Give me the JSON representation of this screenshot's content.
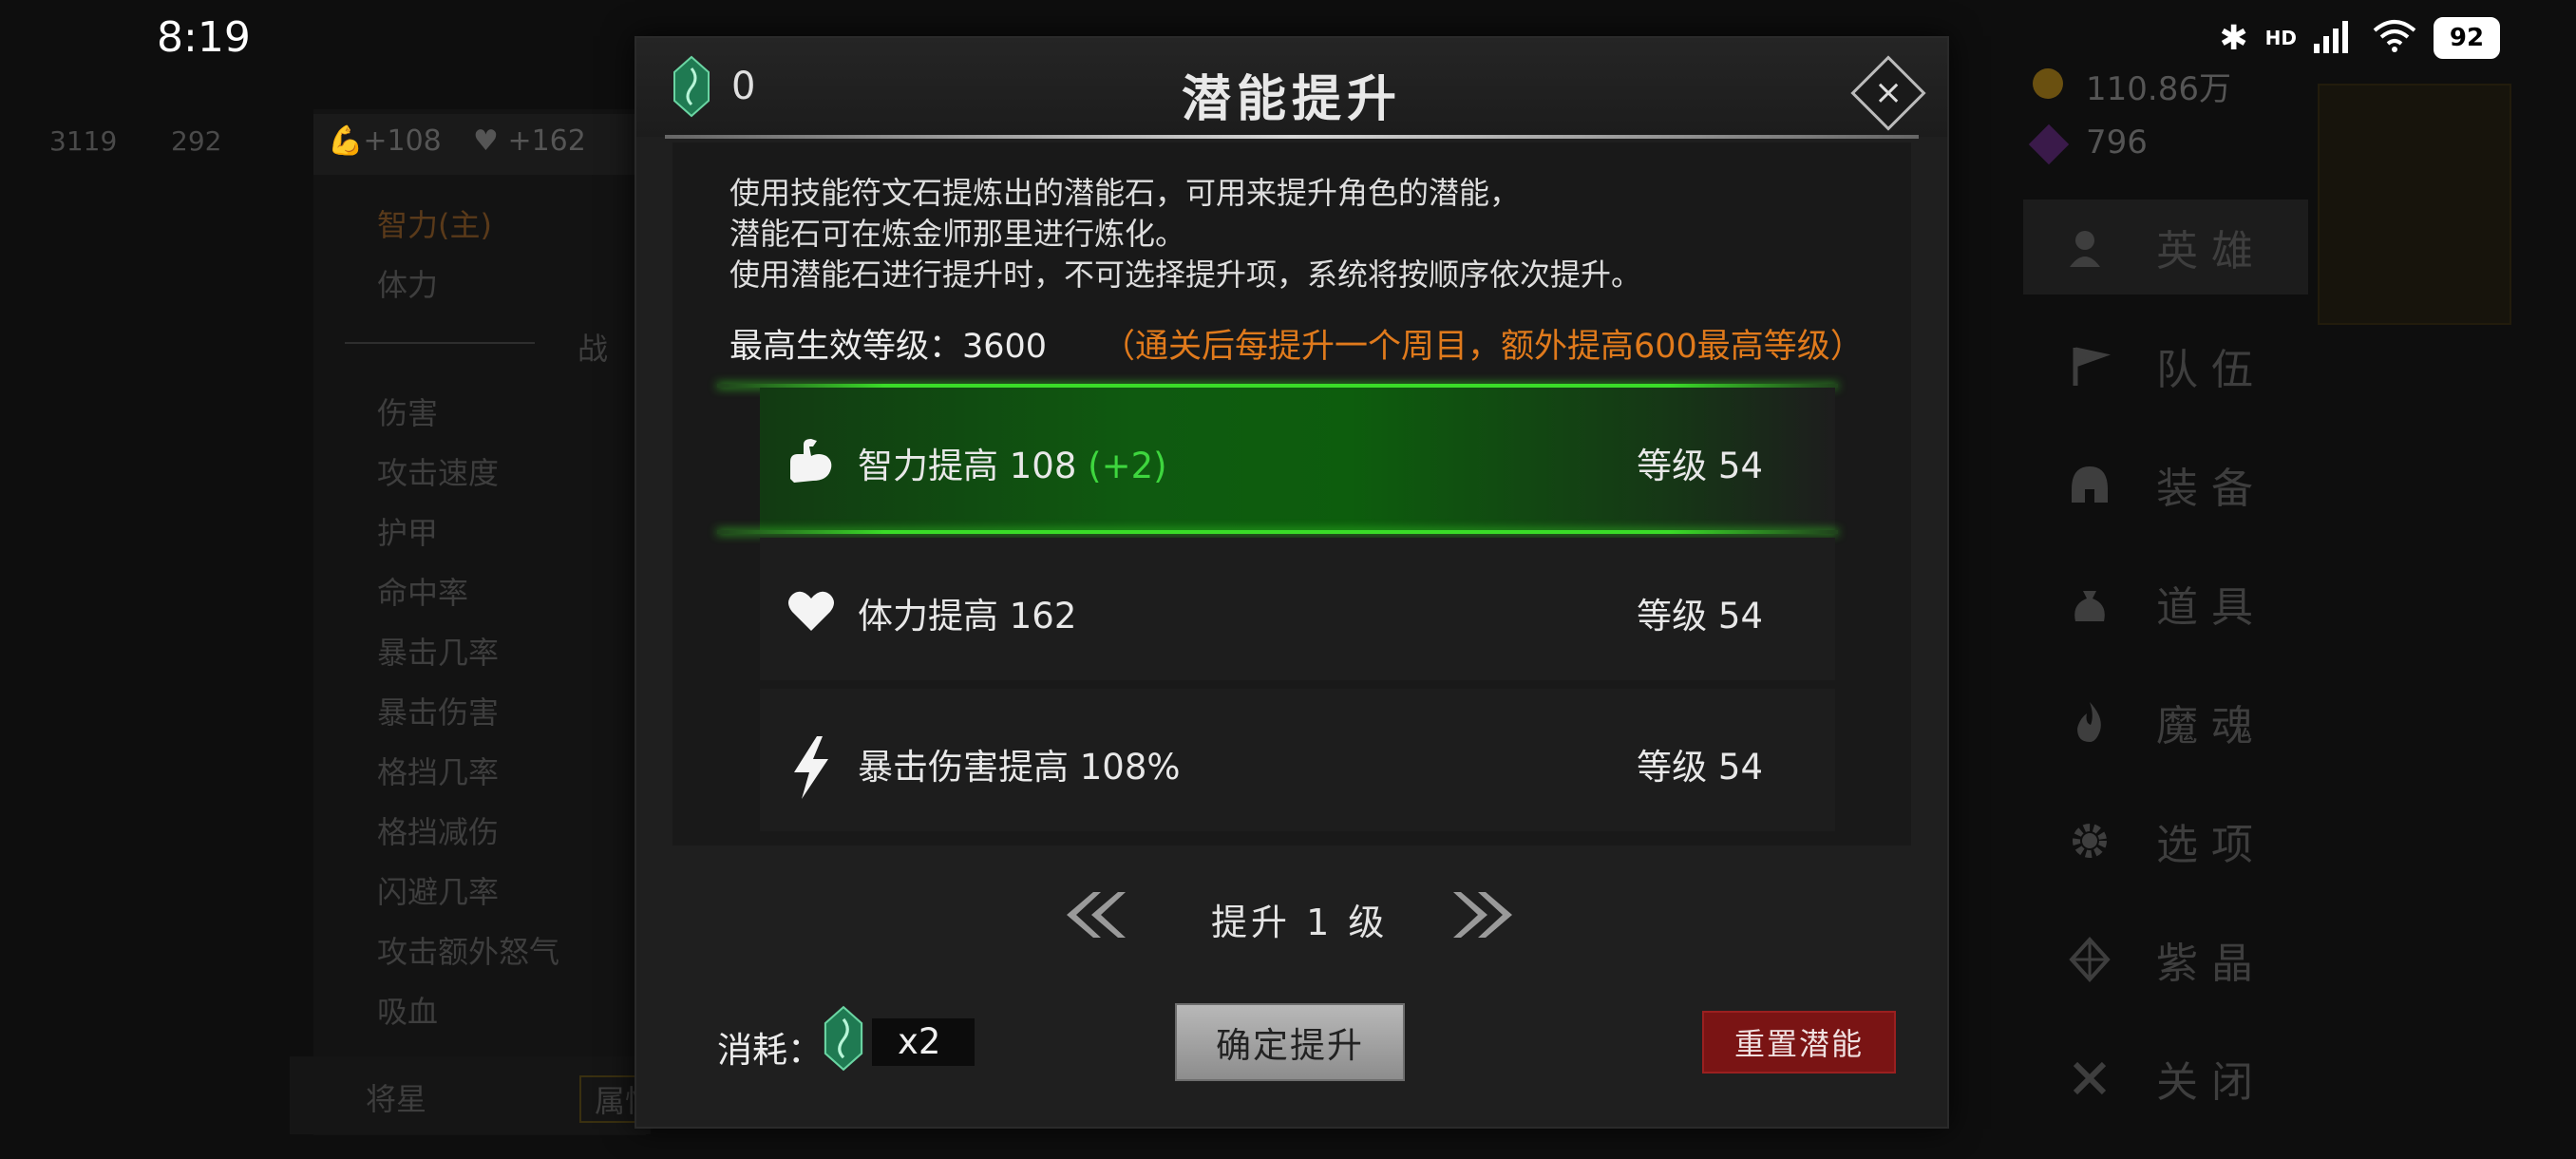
{
  "status_bar": {
    "time": "8:19",
    "battery": "92",
    "network": "HD"
  },
  "background": {
    "hero_stats_top": [
      "3119",
      "292"
    ],
    "bonus_strength": "+108",
    "bonus_vitality": "+162",
    "attributes": [
      "智力(主)",
      "体力"
    ],
    "section_label": "战 斗",
    "stats": [
      "伤害",
      "攻击速度",
      "护甲",
      "命中率",
      "暴击几率",
      "暴击伤害",
      "格挡几率",
      "格挡减伤",
      "闪避几率",
      "攻击额外怒气",
      "吸血"
    ],
    "bottom_tabs": [
      "将星",
      "属性"
    ],
    "gold": "110.86万",
    "crystals": "796",
    "side_menu": [
      {
        "label": "英雄",
        "icon": "hero-icon"
      },
      {
        "label": "队伍",
        "icon": "flag-icon"
      },
      {
        "label": "装备",
        "icon": "helmet-icon"
      },
      {
        "label": "道具",
        "icon": "bag-icon"
      },
      {
        "label": "魔魂",
        "icon": "flame-icon"
      },
      {
        "label": "选项",
        "icon": "gear-icon"
      },
      {
        "label": "紫晶",
        "icon": "crystal-icon"
      },
      {
        "label": "关闭",
        "icon": "close-icon"
      }
    ]
  },
  "modal": {
    "title": "潜能提升",
    "gem_count": "0",
    "description": [
      "使用技能符文石提炼出的潜能石，可用来提升角色的潜能，",
      "潜能石可在炼金师那里进行炼化。",
      "使用潜能石进行提升时，不可选择提升项，系统将按顺序依次提升。"
    ],
    "max_level_label": "最高生效等级：3600",
    "max_level_note": "（通关后每提升一个周目，额外提高600最高等级）",
    "rows": [
      {
        "icon": "muscle-arm-icon",
        "label": "智力提高 108",
        "bonus": "(+2)",
        "level": "等级 54",
        "selected": true
      },
      {
        "icon": "heart-icon",
        "label": "体力提高 162",
        "bonus": "",
        "level": "等级 54",
        "selected": false
      },
      {
        "icon": "lightning-icon",
        "label": "暴击伤害提高 108%",
        "bonus": "",
        "level": "等级 54",
        "selected": false
      }
    ],
    "level_step": "提升 1 级",
    "cost_label": "消耗：",
    "cost_amount": "x2",
    "confirm_button": "确定提升",
    "reset_button": "重置潜能"
  },
  "colors": {
    "accent_green": "#3adc28",
    "note_orange": "#e07a1c",
    "reset_red": "#7a1414",
    "gem_green": "#2fb07a"
  }
}
